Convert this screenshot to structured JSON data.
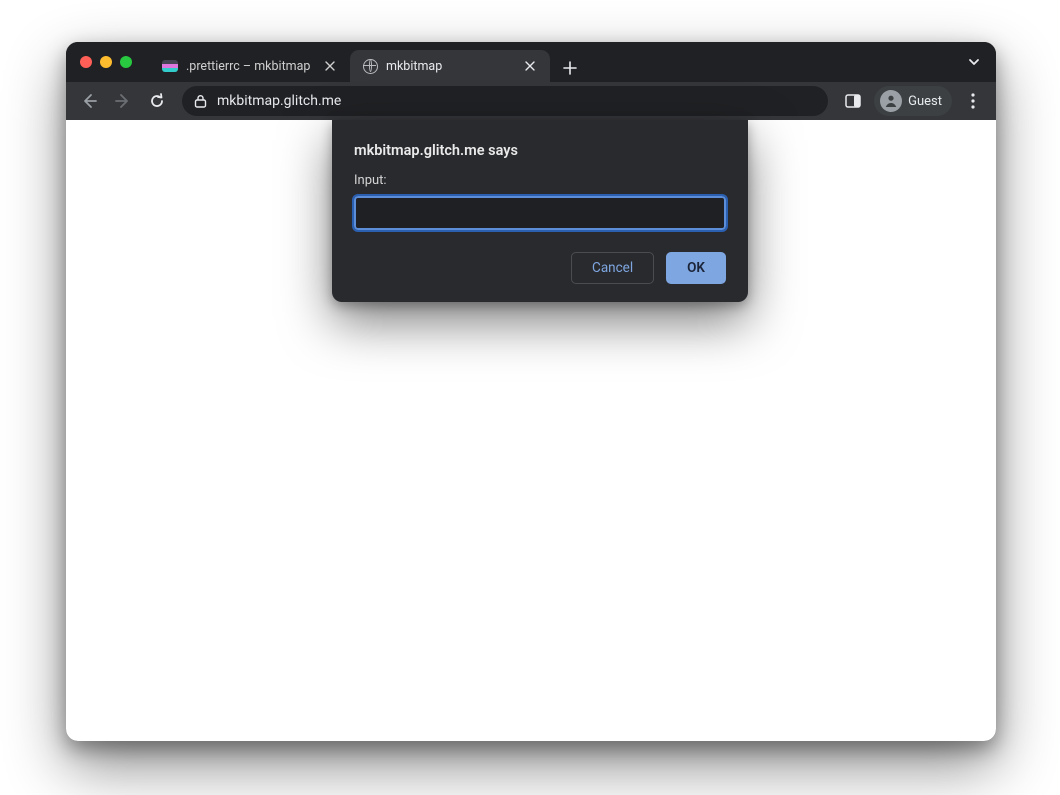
{
  "tabs": [
    {
      "title": ".prettierrc – mkbitmap",
      "active": false
    },
    {
      "title": "mkbitmap",
      "active": true
    }
  ],
  "omnibox": {
    "url": "mkbitmap.glitch.me"
  },
  "profile": {
    "label": "Guest"
  },
  "alert": {
    "origin_text": "mkbitmap.glitch.me says",
    "label": "Input:",
    "value": "",
    "cancel": "Cancel",
    "ok": "OK"
  }
}
